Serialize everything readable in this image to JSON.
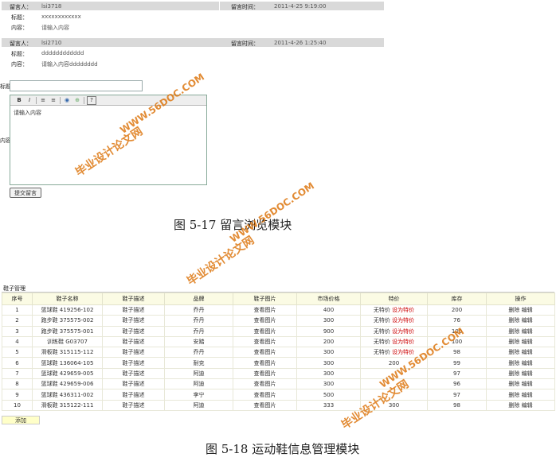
{
  "messages": [
    {
      "author_label": "留言人：",
      "author": "lsi3718",
      "time_label": "留言时间：",
      "time": "2011-4-25 9:19:00",
      "title_label": "标题：",
      "title": "xxxxxxxxxxxx",
      "content_label": "内容：",
      "content": "请输入内容"
    },
    {
      "author_label": "留言人：",
      "author": "lsi2710",
      "time_label": "留言时间：",
      "time": "2011-4-26 1:25:40",
      "title_label": "标题：",
      "title": "dddddddddddd",
      "content_label": "内容：",
      "content": "请输入内容dddddddd"
    }
  ],
  "form": {
    "title_label": "标题",
    "content_label": "内容",
    "editor_text": "请输入内容",
    "toolbar": [
      "B",
      "I",
      "≡",
      "≡",
      "◉",
      "⊕",
      "?"
    ],
    "submit_label": "提交留言"
  },
  "caption1": "图 5-17  留言浏览模块",
  "table": {
    "heading": "鞋子管理",
    "columns": [
      "序号",
      "鞋子名称",
      "鞋子描述",
      "品牌",
      "鞋子图片",
      "市场价格",
      "特价",
      "库存",
      "操作"
    ],
    "rows": [
      [
        "1",
        "篮球鞋 419256-102",
        "鞋子描述",
        "乔丹",
        "查看图片",
        "400",
        "无特价",
        "设为特价",
        "200",
        "删除 编辑"
      ],
      [
        "2",
        "跑步鞋 375575-002",
        "鞋子描述",
        "乔丹",
        "查看图片",
        "300",
        "无特价",
        "设为特价",
        "76",
        "删除 编辑"
      ],
      [
        "3",
        "跑步鞋 375575-001",
        "鞋子描述",
        "乔丹",
        "查看图片",
        "900",
        "无特价",
        "设为特价",
        "100",
        "删除 编辑"
      ],
      [
        "4",
        "训练鞋 G03707",
        "鞋子描述",
        "安踏",
        "查看图片",
        "200",
        "无特价",
        "设为特价",
        "100",
        "删除 编辑"
      ],
      [
        "5",
        "滑板鞋 315115-112",
        "鞋子描述",
        "乔丹",
        "查看图片",
        "300",
        "无特价",
        "设为特价",
        "98",
        "删除 编辑"
      ],
      [
        "6",
        "篮球鞋 136064-105",
        "鞋子描述",
        "耐克",
        "查看图片",
        "300",
        "200",
        "",
        "99",
        "删除 编辑"
      ],
      [
        "7",
        "篮球鞋 429659-005",
        "鞋子描述",
        "阿迪",
        "查看图片",
        "300",
        "",
        "",
        "97",
        "删除 编辑"
      ],
      [
        "8",
        "篮球鞋 429659-006",
        "鞋子描述",
        "阿迪",
        "查看图片",
        "300",
        "",
        "",
        "96",
        "删除 编辑"
      ],
      [
        "9",
        "篮球鞋 436311-002",
        "鞋子描述",
        "李宁",
        "查看图片",
        "500",
        "",
        "",
        "97",
        "删除 编辑"
      ],
      [
        "10",
        "滑板鞋 315122-111",
        "鞋子描述",
        "阿迪",
        "查看图片",
        "333",
        "300",
        "",
        "98",
        "删除 编辑"
      ]
    ],
    "add_label": "添加"
  },
  "caption2": "图 5-18  运动鞋信息管理模块",
  "watermarks": {
    "url": "WWW.56DOC.COM",
    "cn": "毕业设计论文网"
  },
  "colors": {
    "bar": "#d9d9d9",
    "table_header": "#fbfbe4",
    "red_link": "#cc0000",
    "watermark": "#dd7711"
  }
}
